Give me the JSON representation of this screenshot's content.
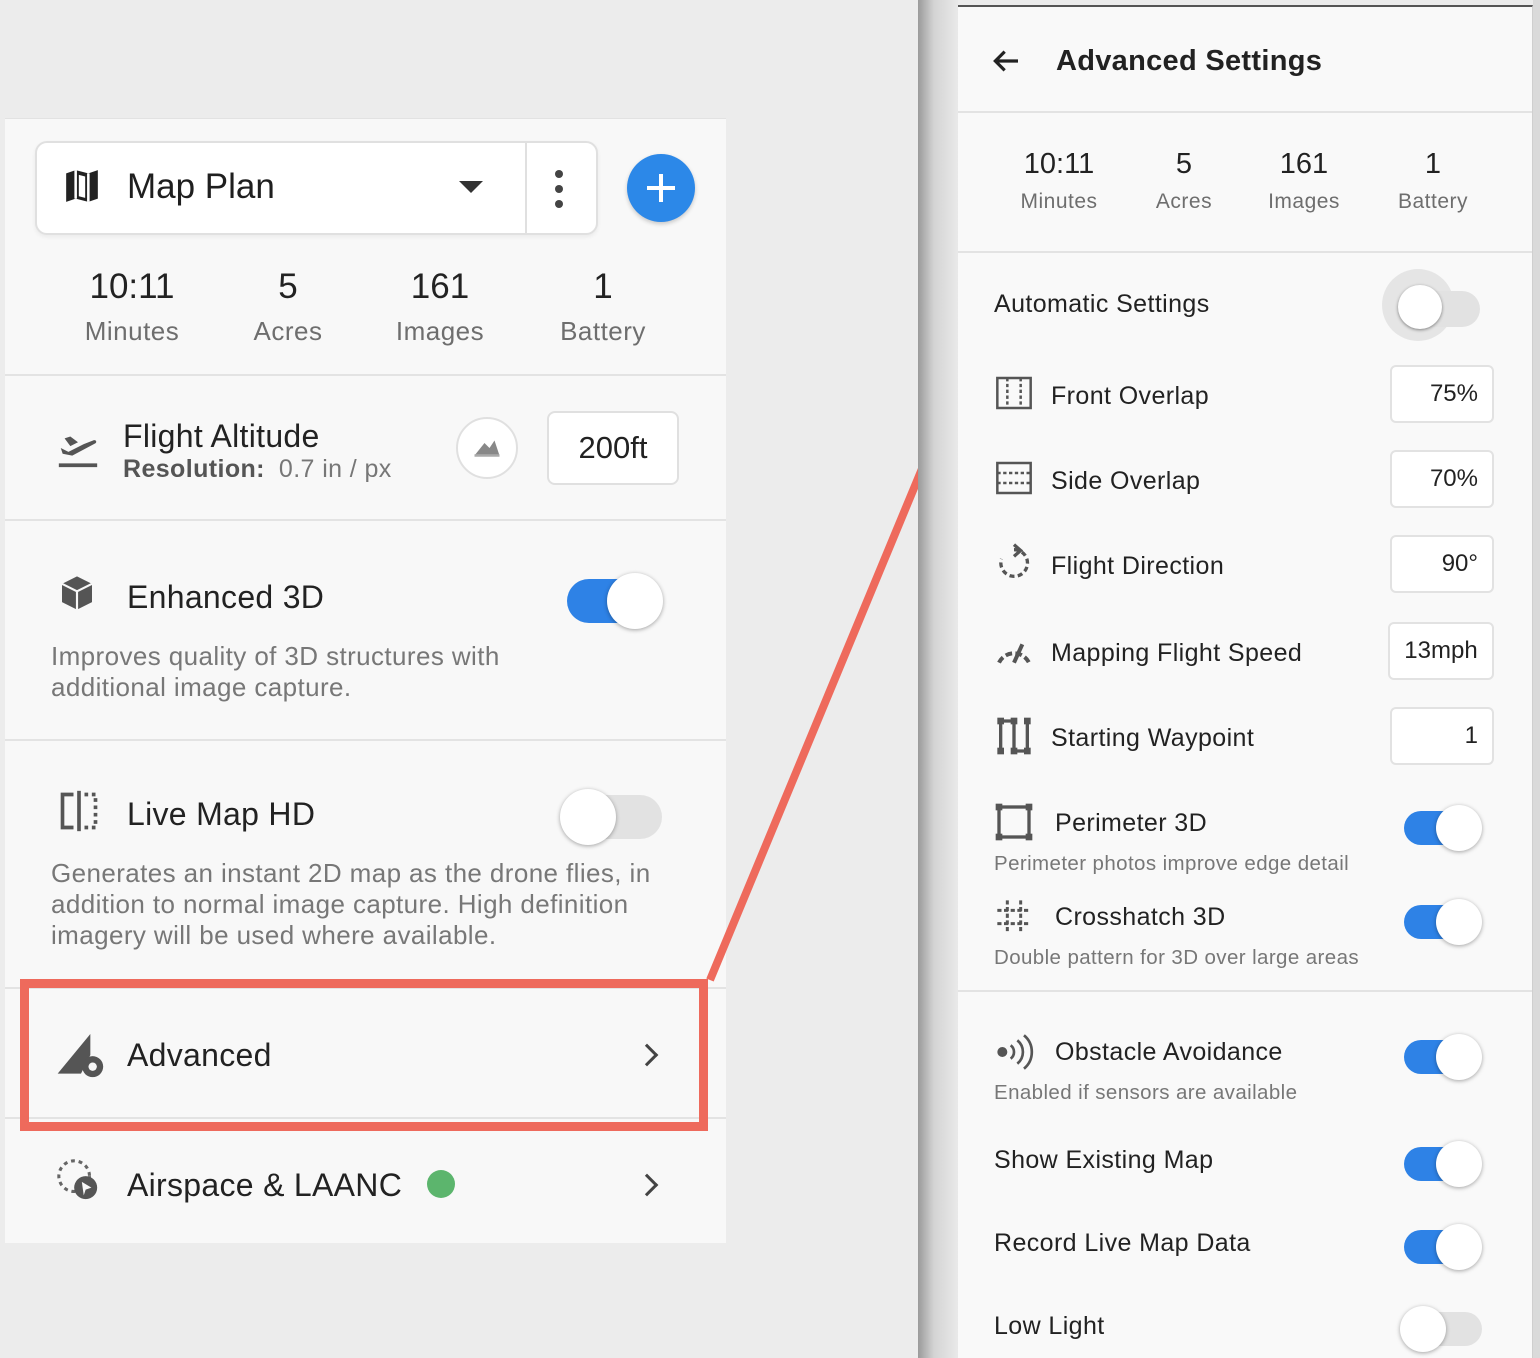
{
  "stats": [
    {
      "value": "10:11",
      "label": "Minutes"
    },
    {
      "value": "5",
      "label": "Acres"
    },
    {
      "value": "161",
      "label": "Images"
    },
    {
      "value": "1",
      "label": "Battery"
    }
  ],
  "left": {
    "plan": {
      "title": "Map Plan"
    },
    "altitude": {
      "title": "Flight Altitude",
      "resolution_label": "Resolution:",
      "resolution_value": "0.7 in / px",
      "value": "200ft"
    },
    "enhanced3d": {
      "title": "Enhanced 3D",
      "description": "Improves quality of 3D structures with additional image capture.",
      "enabled": true
    },
    "livemap": {
      "title": "Live Map HD",
      "description": "Generates an instant 2D map as the drone flies, in addition to normal image capture. High definition imagery will be used where available.",
      "enabled": false
    },
    "advanced": {
      "title": "Advanced"
    },
    "airspace": {
      "title": "Airspace & LAANC",
      "status_color": "#5cb56d"
    }
  },
  "right": {
    "title": "Advanced Settings",
    "automatic": {
      "label": "Automatic Settings",
      "enabled": false
    },
    "front_overlap": {
      "label": "Front Overlap",
      "value": "75%"
    },
    "side_overlap": {
      "label": "Side Overlap",
      "value": "70%"
    },
    "flight_direction": {
      "label": "Flight Direction",
      "value": "90°"
    },
    "speed": {
      "label": "Mapping Flight Speed",
      "value": "13mph"
    },
    "waypoint": {
      "label": "Starting Waypoint",
      "value": "1"
    },
    "perimeter": {
      "label": "Perimeter 3D",
      "sub": "Perimeter photos improve edge detail",
      "enabled": true
    },
    "crosshatch": {
      "label": "Crosshatch 3D",
      "sub": "Double pattern for 3D over large areas",
      "enabled": true
    },
    "obstacle": {
      "label": "Obstacle Avoidance",
      "sub": "Enabled if sensors are available",
      "enabled": true
    },
    "show_map": {
      "label": "Show Existing Map",
      "enabled": true
    },
    "record_live": {
      "label": "Record Live Map Data",
      "enabled": true
    },
    "low_light": {
      "label": "Low Light",
      "enabled": false
    }
  },
  "colors": {
    "accent": "#2e82e6",
    "highlight": "#ee6a5c",
    "status_green": "#5cb56d"
  }
}
